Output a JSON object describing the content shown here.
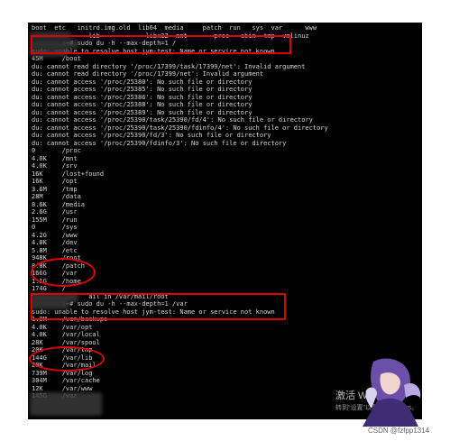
{
  "terminal_lines": [
    "boot  etc   initrd.img.old  lib64  media     patch  run   sys  var      www",
    "               lib            libx32  mnt       proc   sbin  tmp  vmlinuz",
    "        :~# sudo du -h --max-depth=1 /",
    "sudo: unable to resolve host jym-test: Name or service not known",
    "45M     /boot",
    "du: cannot read directory '/proc/17399/task/17399/net': Invalid argument",
    "du: cannot read directory '/proc/17399/net': Invalid argument",
    "du: cannot access '/proc/25380': No such file or directory",
    "du: cannot access '/proc/25385': No such file or directory",
    "du: cannot access '/proc/25386': No such file or directory",
    "du: cannot access '/proc/25388': No such file or directory",
    "du: cannot access '/proc/25389': No such file or directory",
    "du: cannot access '/proc/25390/task/25390/fd/4': No such file or directory",
    "du: cannot access '/proc/25390/task/25390/fdinfo/4': No such file or directory",
    "du: cannot access '/proc/25390/fd/3': No such file or directory",
    "du: cannot access '/proc/25390/fdinfo/3': No such file or directory",
    "0       /proc",
    "4.0K    /mnt",
    "4.0K    /srv",
    "16K     /lost+found",
    "16K     /opt",
    "3.6M    /tmp",
    "28M     /data",
    "8.6K    /media",
    "2.6G    /usr",
    "155M    /run",
    "0       /sys",
    "4.2G    /www",
    "4.0K    /dev",
    "5.8M    /etc",
    "948K    /root",
    "8.0K    /patch",
    "166G    /var",
    "1.1G    /home",
    "174G    /",
    "               ail in /var/mail/root",
    "        :~# sudo du -h --max-depth=1 /var",
    "sudo: unable to resolve host jym-test: Name or service not known",
    "1.9M    /var/backups",
    "4.0K    /var/opt",
    "4.0K    /var/local",
    "28K     /var/spool",
    "20K     /var/tmp",
    "144G    /var/lib",
    "20K     /var/mail",
    "739M    /var/log",
    "304M    /var/cache",
    "12K     /var/www",
    "145G    /var"
  ],
  "watermark": {
    "activate_title": "激活 Windows",
    "activate_sub": "转到\"设置\"以激活 Windows。",
    "credit": "CSDN @fzfpp1314"
  },
  "colors": {
    "annotation": "#e00000",
    "terminal_bg": "#000000",
    "terminal_text": "#d4d4d4"
  }
}
